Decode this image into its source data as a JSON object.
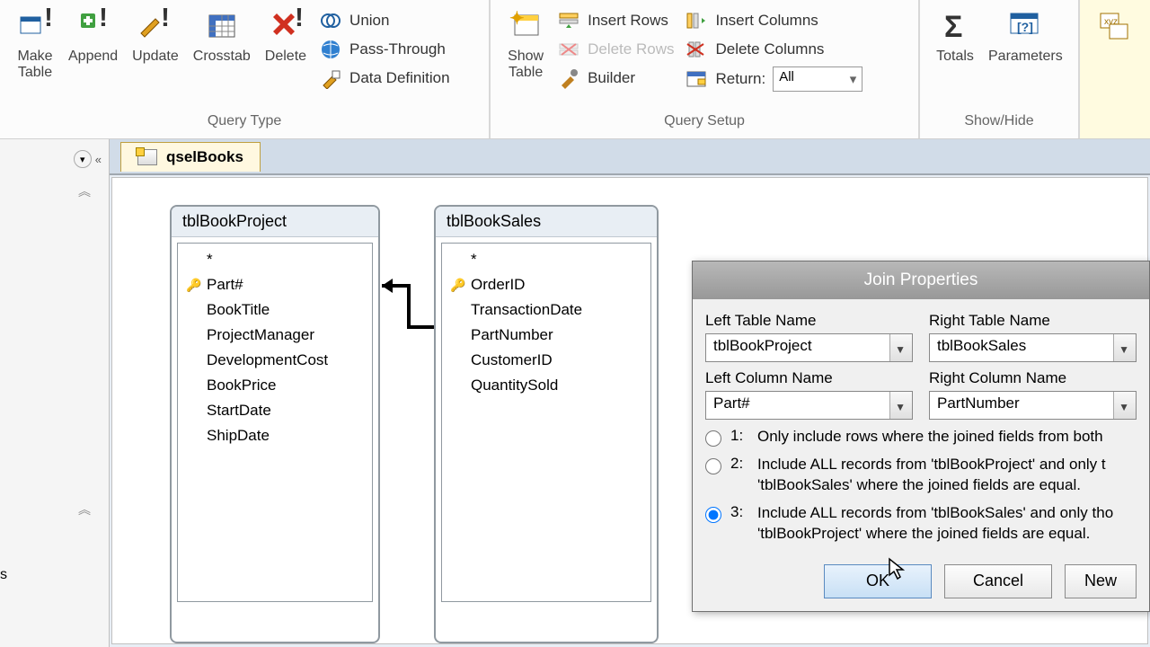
{
  "ribbon": {
    "query_type": {
      "label": "Query Type",
      "make_table": "Make\nTable",
      "append": "Append",
      "update": "Update",
      "crosstab": "Crosstab",
      "delete": "Delete",
      "union": "Union",
      "pass_through": "Pass-Through",
      "data_definition": "Data Definition"
    },
    "query_setup": {
      "label": "Query Setup",
      "show_table": "Show\nTable",
      "insert_rows": "Insert Rows",
      "delete_rows": "Delete Rows",
      "builder": "Builder",
      "insert_columns": "Insert Columns",
      "delete_columns": "Delete Columns",
      "return": "Return:",
      "return_value": "All"
    },
    "show_hide": {
      "label": "Show/Hide",
      "totals": "Totals",
      "parameters": "Parameters"
    }
  },
  "tab": {
    "name": "qselBooks"
  },
  "tables": {
    "left": {
      "title": "tblBookProject",
      "star": "*",
      "fields": [
        "Part#",
        "BookTitle",
        "ProjectManager",
        "DevelopmentCost",
        "BookPrice",
        "StartDate",
        "ShipDate"
      ],
      "key_index": 0
    },
    "right": {
      "title": "tblBookSales",
      "star": "*",
      "fields": [
        "OrderID",
        "TransactionDate",
        "PartNumber",
        "CustomerID",
        "QuantitySold"
      ],
      "key_index": 0
    }
  },
  "dialog": {
    "title": "Join Properties",
    "left_table_label": "Left Table Name",
    "right_table_label": "Right Table Name",
    "left_table_value": "tblBookProject",
    "right_table_value": "tblBookSales",
    "left_col_label": "Left Column Name",
    "right_col_label": "Right Column Name",
    "left_col_value": "Part#",
    "right_col_value": "PartNumber",
    "opt1_num": "1:",
    "opt1_text": "Only include rows where the joined fields from both",
    "opt2_num": "2:",
    "opt2_text": "Include ALL records from 'tblBookProject' and only t                         'tblBookSales' where the joined fields are equal.",
    "opt3_num": "3:",
    "opt3_text": "Include ALL records from 'tblBookSales' and only tho 'tblBookProject' where the joined fields are equal.",
    "selected": 3,
    "ok": "OK",
    "cancel": "Cancel",
    "new": "New"
  },
  "nav": {
    "item": "s"
  }
}
